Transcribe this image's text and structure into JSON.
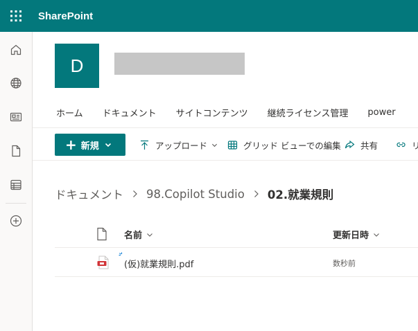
{
  "suite": {
    "title": "SharePoint",
    "accent": "#03787c"
  },
  "rail": {
    "items": [
      {
        "name": "home-icon"
      },
      {
        "name": "globe-icon"
      },
      {
        "name": "news-icon"
      },
      {
        "name": "file-icon"
      },
      {
        "name": "list-icon"
      },
      {
        "name": "add-circle-icon"
      }
    ]
  },
  "site": {
    "logo_letter": "D"
  },
  "topnav": {
    "items": [
      "ホーム",
      "ドキュメント",
      "サイトコンテンツ",
      "継続ライセンス管理",
      "power"
    ]
  },
  "commandbar": {
    "new_label": "新規",
    "upload_label": "アップロード",
    "grid_edit_label": "グリッド ビューでの編集",
    "share_label": "共有",
    "link_label": "リ"
  },
  "breadcrumb": {
    "items": [
      "ドキュメント",
      "98.Copilot Studio"
    ],
    "current": "02.就業規則"
  },
  "list": {
    "columns": {
      "name": "名前",
      "modified": "更新日時"
    },
    "rows": [
      {
        "name": "(仮)就業規則.pdf",
        "modified": "数秒前",
        "type": "pdf",
        "is_new": true
      }
    ]
  }
}
